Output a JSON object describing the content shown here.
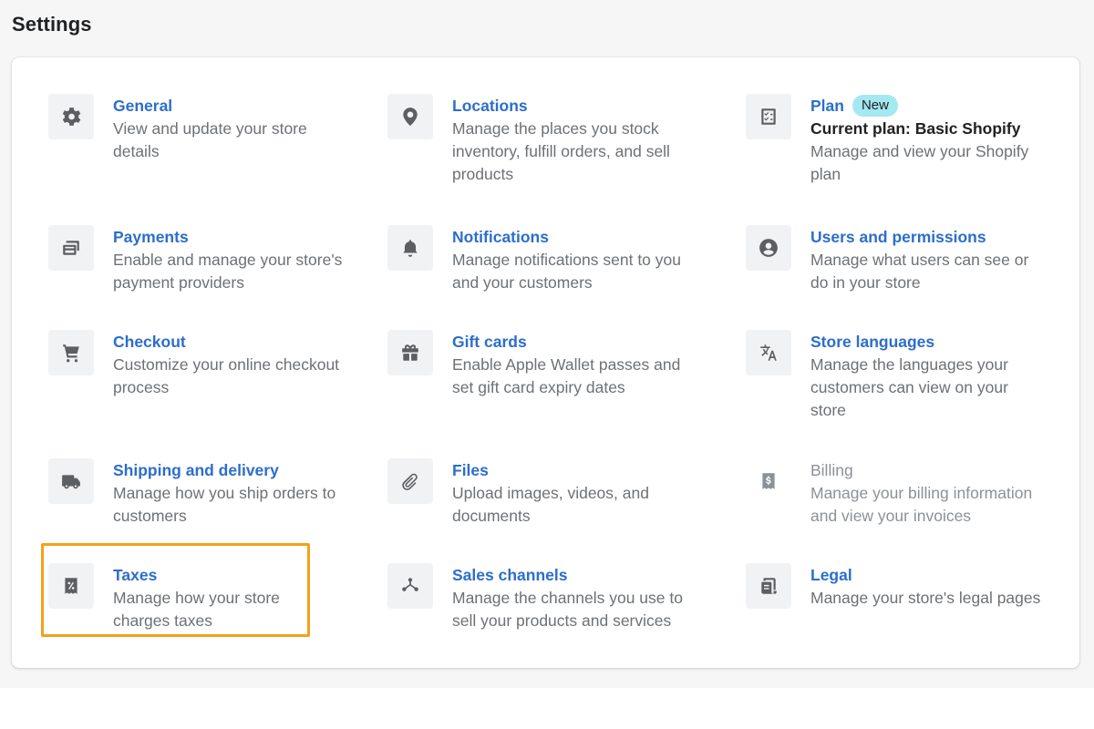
{
  "page": {
    "title": "Settings"
  },
  "items": {
    "general": {
      "title": "General",
      "desc": "View and update your store details",
      "icon": "gear-icon"
    },
    "locations": {
      "title": "Locations",
      "desc": "Manage the places you stock inventory, fulfill orders, and sell products",
      "icon": "location-pin-icon"
    },
    "plan": {
      "title": "Plan",
      "badge": "New",
      "subtitle": "Current plan: Basic Shopify",
      "desc": "Manage and view your Shopify plan",
      "icon": "checklist-icon"
    },
    "payments": {
      "title": "Payments",
      "desc": "Enable and manage your store's payment providers",
      "icon": "card-icon"
    },
    "notifications": {
      "title": "Notifications",
      "desc": "Manage notifications sent to you and your customers",
      "icon": "bell-icon"
    },
    "users": {
      "title": "Users and permissions",
      "desc": "Manage what users can see or do in your store",
      "icon": "user-circle-icon"
    },
    "checkout": {
      "title": "Checkout",
      "desc": "Customize your online checkout process",
      "icon": "cart-icon"
    },
    "gift_cards": {
      "title": "Gift cards",
      "desc": "Enable Apple Wallet passes and set gift card expiry dates",
      "icon": "gift-icon"
    },
    "languages": {
      "title": "Store languages",
      "desc": "Manage the languages your customers can view on your store",
      "icon": "translate-icon"
    },
    "shipping": {
      "title": "Shipping and delivery",
      "desc": "Manage how you ship orders to customers",
      "icon": "truck-icon"
    },
    "files": {
      "title": "Files",
      "desc": "Upload images, videos, and documents",
      "icon": "paperclip-icon"
    },
    "billing": {
      "title": "Billing",
      "desc": "Manage your billing information and view your invoices",
      "icon": "dollar-receipt-icon"
    },
    "taxes": {
      "title": "Taxes",
      "desc": "Manage how your store charges taxes",
      "icon": "tax-receipt-icon"
    },
    "sales_channels": {
      "title": "Sales channels",
      "desc": "Manage the channels you use to sell your products and services",
      "icon": "channels-icon"
    },
    "legal": {
      "title": "Legal",
      "desc": "Manage your store's legal pages",
      "icon": "legal-document-icon"
    }
  },
  "colors": {
    "link": "#2c6ecb",
    "highlight": "#f4a118",
    "badge": "#a4e8f2"
  }
}
